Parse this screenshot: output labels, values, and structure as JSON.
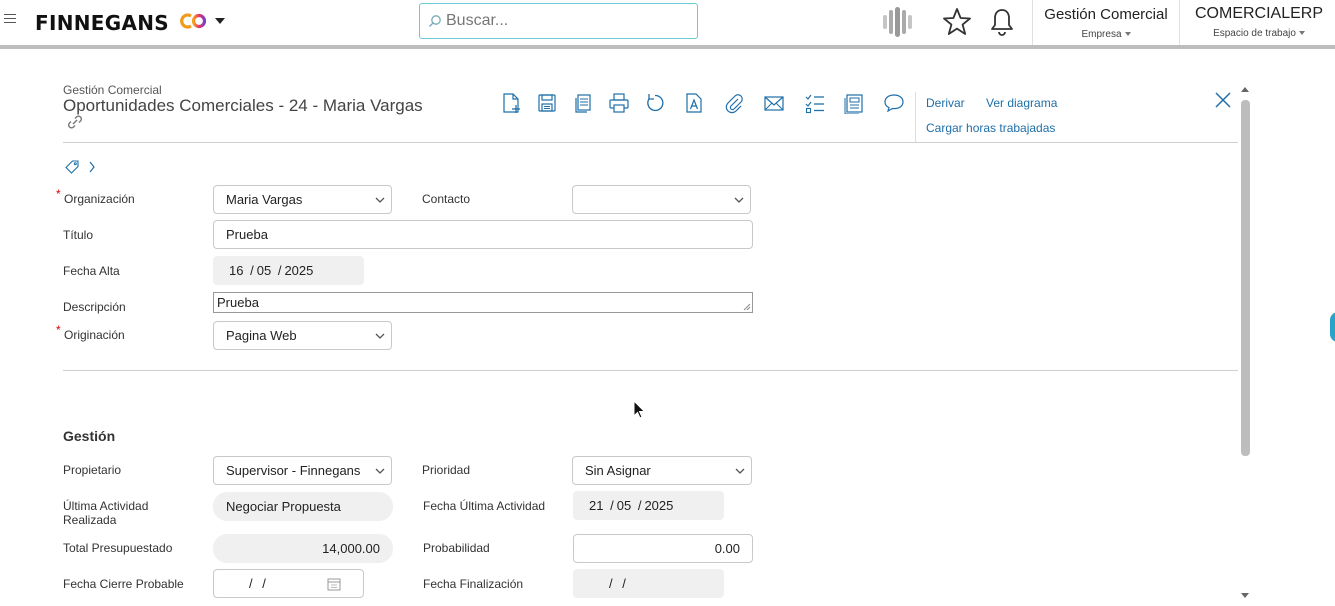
{
  "topbar": {
    "brand": "FINNEGANS",
    "search_placeholder": "Buscar...",
    "module_main": "Gestión Comercial",
    "module_sub": "Empresa",
    "workspace_main": "COMERCIALERP",
    "workspace_sub": "Espacio de trabajo"
  },
  "header": {
    "module": "Gestión Comercial",
    "title": "Oportunidades Comerciales - 24 - Maria Vargas",
    "links": {
      "derivar": "Derivar",
      "diagram": "Ver diagrama",
      "hours": "Cargar horas trabajadas"
    }
  },
  "form": {
    "organizacion": {
      "label": "Organización",
      "value": "Maria Vargas"
    },
    "contacto": {
      "label": "Contacto",
      "value": ""
    },
    "titulo": {
      "label": "Título",
      "value": "Prueba"
    },
    "fecha_alta": {
      "label": "Fecha Alta",
      "day": "16",
      "month": "05",
      "year": "2025"
    },
    "descripcion": {
      "label": "Descripción",
      "value": "Prueba"
    },
    "originacion": {
      "label": "Originación",
      "value": "Pagina Web"
    }
  },
  "gestion": {
    "title": "Gestión",
    "propietario": {
      "label": "Propietario",
      "value": "Supervisor - Finnegans"
    },
    "prioridad": {
      "label": "Prioridad",
      "value": "Sin Asignar"
    },
    "ultima_actividad": {
      "label": "Última Actividad Realizada",
      "value": "Negociar Propuesta"
    },
    "fecha_ultima_actividad": {
      "label": "Fecha Última Actividad",
      "day": "21",
      "month": "05",
      "year": "2025"
    },
    "total_presupuestado": {
      "label": "Total Presupuestado",
      "value": "14,000.00"
    },
    "probabilidad": {
      "label": "Probabilidad",
      "value": "0.00"
    },
    "fecha_cierre_probable": {
      "label": "Fecha Cierre Probable",
      "value": "/     /"
    },
    "fecha_finalizacion": {
      "label": "Fecha Finalización",
      "value": "/     /"
    }
  },
  "colors": {
    "accent": "#1f6fa8",
    "search_border": "#6fc8d8",
    "required": "#dd0000"
  }
}
